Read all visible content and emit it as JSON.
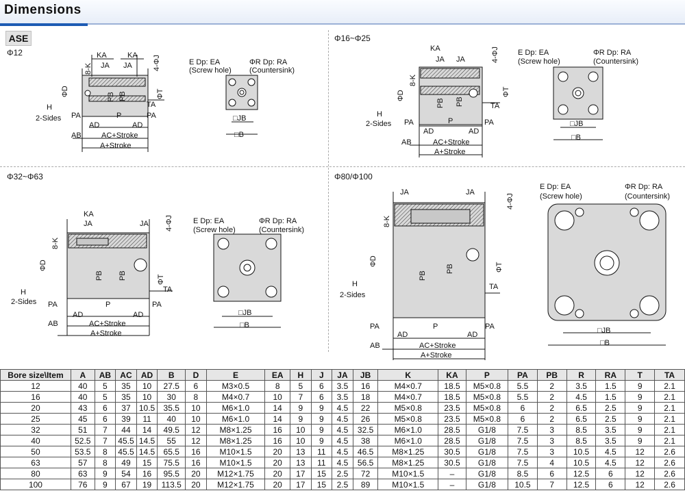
{
  "header": {
    "title": "Dimensions"
  },
  "model": "ASE",
  "sections": {
    "s12": "Φ12",
    "s16": "Φ16~Φ25",
    "s32": "Φ32~Φ63",
    "s80": "Φ80/Φ100"
  },
  "labels": {
    "KA": "KA",
    "JA": "JA",
    "PA": "PA",
    "P": "P",
    "AD": "AD",
    "AB": "AB",
    "TA": "TA",
    "PB": "PB",
    "phiD": "ΦD",
    "phiT": "ΦT",
    "fourJ": "4-ΦJ",
    "eightK": "8-K",
    "H": "H",
    "twoSides": "2-Sides",
    "acStroke": "AC+Stroke",
    "aStroke": "A+Stroke",
    "edp": "E Dp: EA",
    "screwHole": "(Screw hole)",
    "rdp": "ΦR Dp: RA",
    "countersink": "(Countersink)",
    "jb": "□JB",
    "b": "□B"
  },
  "table": {
    "headers": [
      "Bore size\\Item",
      "A",
      "AB",
      "AC",
      "AD",
      "B",
      "D",
      "E",
      "EA",
      "H",
      "J",
      "JA",
      "JB",
      "K",
      "KA",
      "P",
      "PA",
      "PB",
      "R",
      "RA",
      "T",
      "TA"
    ],
    "rows": [
      [
        "12",
        "40",
        "5",
        "35",
        "10",
        "27.5",
        "6",
        "M3×0.5",
        "8",
        "5",
        "6",
        "3.5",
        "16",
        "M4×0.7",
        "18.5",
        "M5×0.8",
        "5.5",
        "2",
        "3.5",
        "1.5",
        "9",
        "2.1"
      ],
      [
        "16",
        "40",
        "5",
        "35",
        "10",
        "30",
        "8",
        "M4×0.7",
        "10",
        "7",
        "6",
        "3.5",
        "18",
        "M4×0.7",
        "18.5",
        "M5×0.8",
        "5.5",
        "2",
        "4.5",
        "1.5",
        "9",
        "2.1"
      ],
      [
        "20",
        "43",
        "6",
        "37",
        "10.5",
        "35.5",
        "10",
        "M6×1.0",
        "14",
        "9",
        "9",
        "4.5",
        "22",
        "M5×0.8",
        "23.5",
        "M5×0.8",
        "6",
        "2",
        "6.5",
        "2.5",
        "9",
        "2.1"
      ],
      [
        "25",
        "45",
        "6",
        "39",
        "11",
        "40",
        "10",
        "M6×1.0",
        "14",
        "9",
        "9",
        "4.5",
        "26",
        "M5×0.8",
        "23.5",
        "M5×0.8",
        "6",
        "2",
        "6.5",
        "2.5",
        "9",
        "2.1"
      ],
      [
        "32",
        "51",
        "7",
        "44",
        "14",
        "49.5",
        "12",
        "M8×1.25",
        "16",
        "10",
        "9",
        "4.5",
        "32.5",
        "M6×1.0",
        "28.5",
        "G1/8",
        "7.5",
        "3",
        "8.5",
        "3.5",
        "9",
        "2.1"
      ],
      [
        "40",
        "52.5",
        "7",
        "45.5",
        "14.5",
        "55",
        "12",
        "M8×1.25",
        "16",
        "10",
        "9",
        "4.5",
        "38",
        "M6×1.0",
        "28.5",
        "G1/8",
        "7.5",
        "3",
        "8.5",
        "3.5",
        "9",
        "2.1"
      ],
      [
        "50",
        "53.5",
        "8",
        "45.5",
        "14.5",
        "65.5",
        "16",
        "M10×1.5",
        "20",
        "13",
        "11",
        "4.5",
        "46.5",
        "M8×1.25",
        "30.5",
        "G1/8",
        "7.5",
        "3",
        "10.5",
        "4.5",
        "12",
        "2.6"
      ],
      [
        "63",
        "57",
        "8",
        "49",
        "15",
        "75.5",
        "16",
        "M10×1.5",
        "20",
        "13",
        "11",
        "4.5",
        "56.5",
        "M8×1.25",
        "30.5",
        "G1/8",
        "7.5",
        "4",
        "10.5",
        "4.5",
        "12",
        "2.6"
      ],
      [
        "80",
        "63",
        "9",
        "54",
        "16",
        "95.5",
        "20",
        "M12×1.75",
        "20",
        "17",
        "15",
        "2.5",
        "72",
        "M10×1.5",
        "–",
        "G1/8",
        "8.5",
        "6",
        "12.5",
        "6",
        "12",
        "2.6"
      ],
      [
        "100",
        "76",
        "9",
        "67",
        "19",
        "113.5",
        "20",
        "M12×1.75",
        "20",
        "17",
        "15",
        "2.5",
        "89",
        "M10×1.5",
        "–",
        "G1/8",
        "10.5",
        "7",
        "12.5",
        "6",
        "12",
        "2.6"
      ]
    ]
  }
}
